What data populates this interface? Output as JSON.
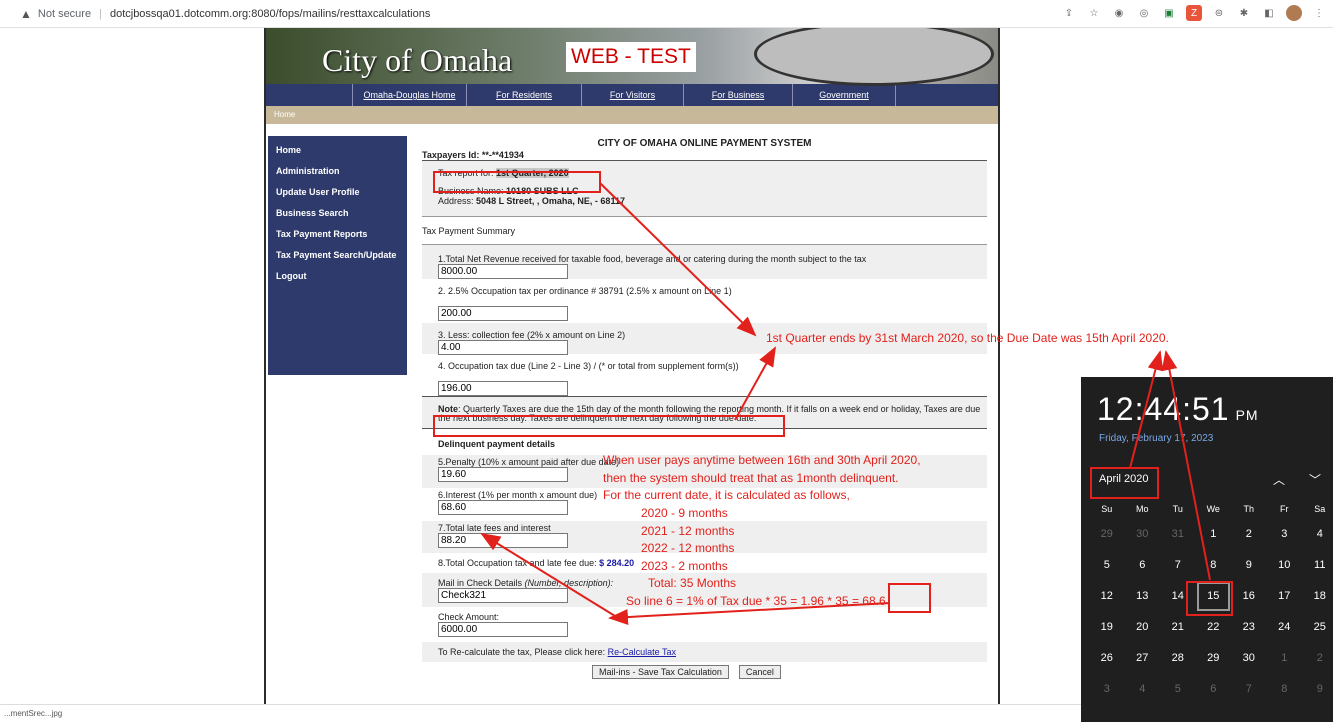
{
  "browser": {
    "security_label": "Not secure",
    "url": "dotcjbossqa01.dotcomm.org:8080/fops/mailins/resttaxcalculations"
  },
  "header": {
    "logo_text": "City of Omaha",
    "env_badge": "WEB - TEST"
  },
  "nav": [
    "Omaha-Douglas Home",
    "For Residents",
    "For Visitors",
    "For Business",
    "Government"
  ],
  "breadcrumb": "Home",
  "sidebar": [
    "Home",
    "Administration",
    "Update User Profile",
    "Business Search",
    "Tax Payment Reports",
    "Tax Payment Search/Update",
    "Logout"
  ],
  "main": {
    "title": "CITY OF OMAHA ONLINE PAYMENT SYSTEM",
    "taxpayer_id": "Taxpayers Id: **-**41934",
    "report_label": "Tax report for:",
    "report_period": "1st Quarter, 2020",
    "business_name_label": "Business Name:",
    "business_name": "10180 SUBS LLC",
    "address_label": "Address:",
    "address": "5048 L Street, , Omaha, NE, - 68117",
    "summary_heading": "Tax Payment Summary",
    "line1_label": "1.Total Net Revenue received for taxable food, beverage and or catering during the month subject to the tax",
    "line1_value": "8000.00",
    "line2_label": "2. 2.5% Occupation tax per ordinance # 38791 (2.5% x amount on Line 1)",
    "line2_value": "200.00",
    "line3_label": "3. Less: collection fee (2% x amount on Line 2)",
    "line3_value": "4.00",
    "line4_label": "4. Occupation tax due (Line 2 - Line 3) / (* or total from supplement form(s))",
    "line4_value": "196.00",
    "note_label": "Note",
    "note_text": ": Quarterly Taxes are due the 15th day of the month following the reporting month. If it falls on a week end or holiday, Taxes are due the next business day. Taxes are delinquent the next day following the due date.",
    "delinquent_heading": "Delinquent payment details",
    "line5_label": "5.Penalty (10% x amount paid after due date)",
    "line5_value": "19.60",
    "line6_label": "6.Interest (1% per month x amount due)",
    "line6_value": "68.60",
    "line7_label": "7.Total late fees and interest",
    "line7_value": "88.20",
    "line8_label": "8.Total Occupation tax and late fee due:",
    "line8_value": "$ 284.20",
    "check_details_label": "Mail in Check Details",
    "check_details_hint": "(Number, description):",
    "check_details_value": "Check321",
    "check_amount_label": "Check Amount:",
    "check_amount_value": "6000.00",
    "recalc_text": "To Re-calculate the tax, Please click here:",
    "recalc_link": "Re-Calculate Tax",
    "btn_save": "Mail-ins - Save Tax Calculation",
    "btn_cancel": "Cancel"
  },
  "clock": {
    "time": "12:44:51",
    "ampm": "PM",
    "date": "Friday, February 17, 2023",
    "month": "April 2020",
    "weekdays": [
      "Su",
      "Mo",
      "Tu",
      "We",
      "Th",
      "Fr",
      "Sa"
    ],
    "days": [
      "29",
      "30",
      "31",
      "1",
      "2",
      "3",
      "4",
      "5",
      "6",
      "7",
      "8",
      "9",
      "10",
      "11",
      "12",
      "13",
      "14",
      "15",
      "16",
      "17",
      "18",
      "19",
      "20",
      "21",
      "22",
      "23",
      "24",
      "25",
      "26",
      "27",
      "28",
      "29",
      "30",
      "1",
      "2",
      "3",
      "4",
      "5",
      "6",
      "7",
      "8",
      "9"
    ]
  },
  "annotations": {
    "due_note": "1st Quarter ends by 31st March 2020, so the Due Date was 15th April 2020.",
    "delinquent_note": [
      "When user pays anytime between 16th and 30th April 2020,",
      "then the system should treat that as 1month delinquent.",
      "For the current date, it is calculated as follows,"
    ],
    "months": [
      "2020 - 9 months",
      "2021 - 12 months",
      "2022 - 12 months",
      "2023 - 2 months"
    ],
    "total": "Total: 35 Months",
    "formula": "So line 6 = 1% of Tax due * 35 = 1.96 * 35 = 68.6"
  },
  "download_bar": "...mentSrec...jpg"
}
